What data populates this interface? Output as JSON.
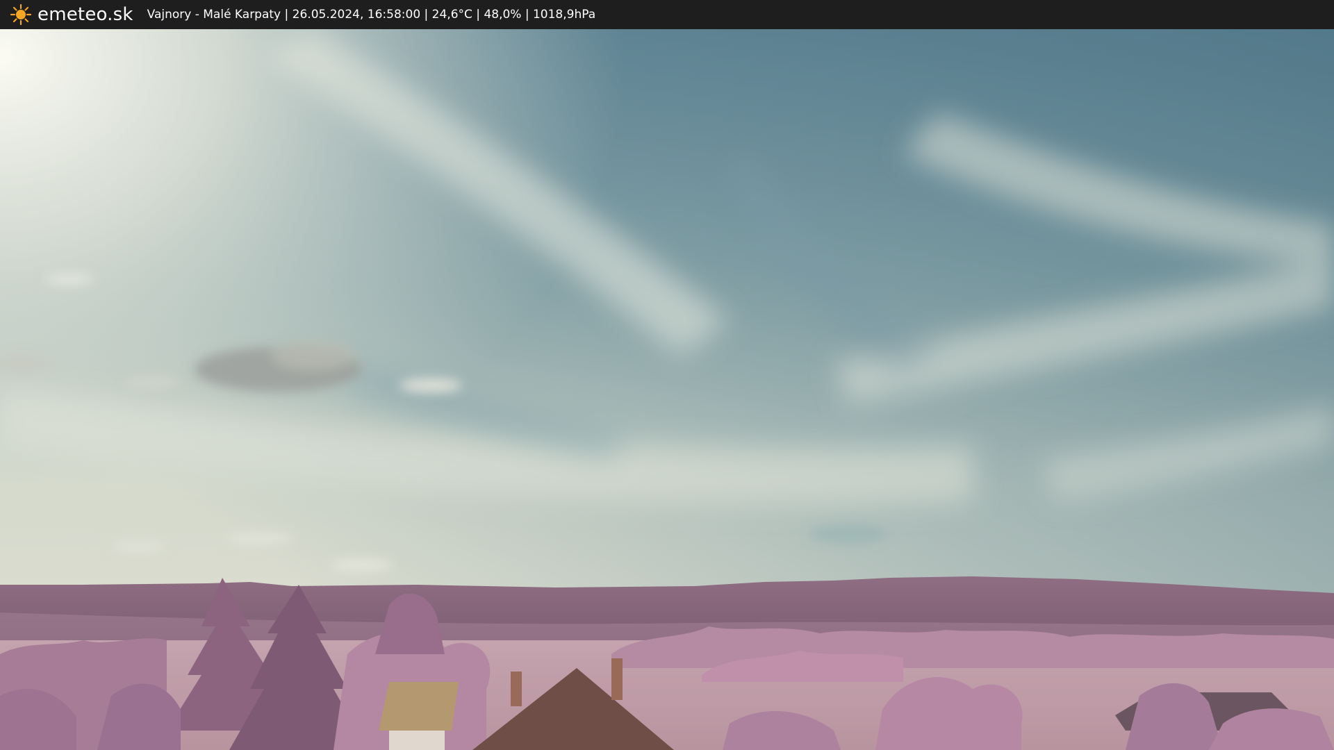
{
  "header": {
    "brand": "emeteo.sk",
    "caption": "Vajnory - Malé Karpaty | 26.05.2024, 16:58:00 | 24,6°C | 48,0% | 1018,9hPa",
    "logo_icon": "sun-icon"
  },
  "colors": {
    "bar_background": "#1e1e1e",
    "sun_color": "#f5a623",
    "sky_top": "#5e8592",
    "sky_horizon": "#d8ddd0",
    "hills": "#8a6a80",
    "foliage": "#b88aa4",
    "field": "#c9a9b3"
  }
}
